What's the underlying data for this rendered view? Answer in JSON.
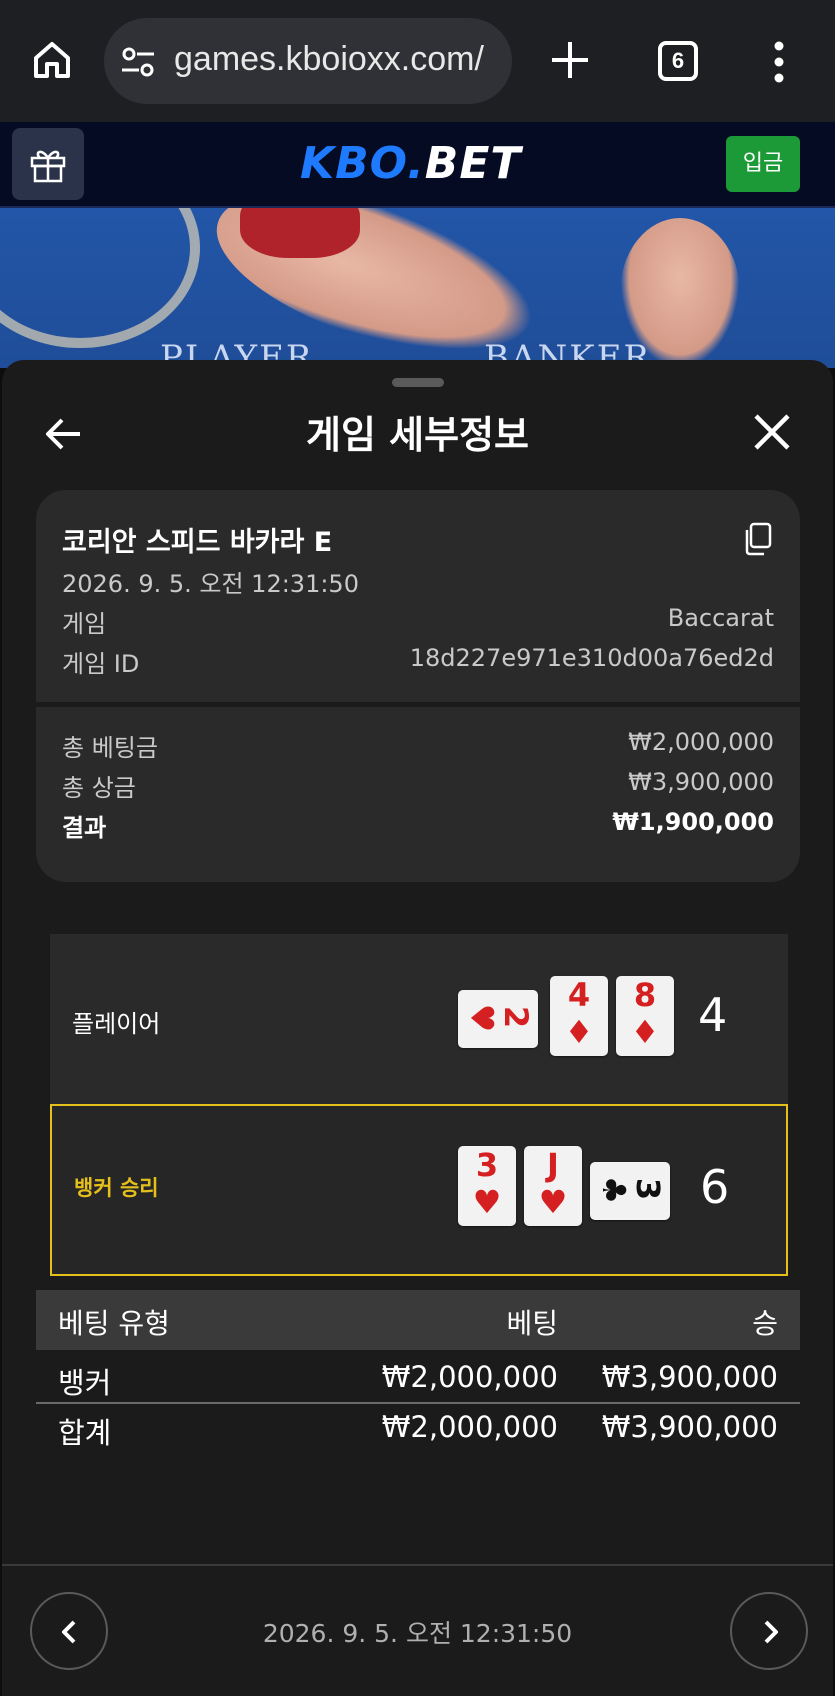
{
  "browser": {
    "url": "games.kboioxx.com/",
    "tab_count": "6"
  },
  "site": {
    "logo_kbo": "KBO",
    "logo_dot": ".",
    "logo_bet": "BET",
    "deposit_label": "입금"
  },
  "video": {
    "player_label": "PLAYER",
    "banker_label": "BANKER"
  },
  "sheet": {
    "title": "게임 세부정보",
    "game_name": "코리안 스피드 바카라 E",
    "game_time": "2026. 9. 5. 오전 12:31:50",
    "game_label": "게임",
    "game_value": "Baccarat",
    "game_id_label": "게임 ID",
    "game_id_value": "18d227e971e310d00a76ed2d",
    "total_bet_label": "총 베팅금",
    "total_bet_value": "₩2,000,000",
    "total_prize_label": "총 상금",
    "total_prize_value": "₩3,900,000",
    "result_label": "결과",
    "result_value": "₩1,900,000"
  },
  "hands": {
    "player": {
      "label": "플레이어",
      "total": "4",
      "cards": [
        {
          "rank": "2",
          "suit": "♥",
          "color": "#d42020",
          "sideways": true
        },
        {
          "rank": "4",
          "suit": "♦",
          "color": "#d42020",
          "sideways": false
        },
        {
          "rank": "8",
          "suit": "♦",
          "color": "#d42020",
          "sideways": false
        }
      ]
    },
    "banker": {
      "label": "뱅커 승리",
      "total": "6",
      "cards": [
        {
          "rank": "3",
          "suit": "♥",
          "color": "#d42020",
          "sideways": false
        },
        {
          "rank": "J",
          "suit": "♥",
          "color": "#d42020",
          "sideways": false
        },
        {
          "rank": "3",
          "suit": "♣",
          "color": "#111111",
          "sideways": true
        }
      ]
    }
  },
  "bets_table": {
    "headers": [
      "베팅 유형",
      "베팅",
      "승"
    ],
    "rows": [
      [
        "뱅커",
        "₩2,000,000",
        "₩3,900,000"
      ],
      [
        "합계",
        "₩2,000,000",
        "₩3,900,000"
      ]
    ]
  },
  "footer": {
    "time": "2026. 9. 5. 오전 12:31:50"
  },
  "colors": {
    "winner_accent": "#e5c01b",
    "deposit_green": "#1c9a37",
    "logo_blue": "#1e7bff"
  }
}
